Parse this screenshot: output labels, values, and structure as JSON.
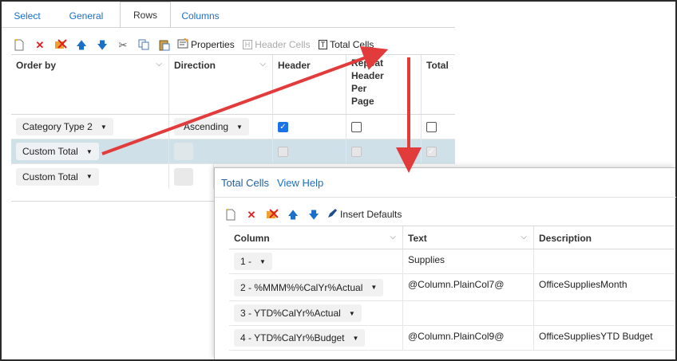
{
  "tabs": [
    {
      "label": "Select"
    },
    {
      "label": "General"
    },
    {
      "label": "Rows"
    },
    {
      "label": "Columns"
    }
  ],
  "toolbar": {
    "properties_label": "Properties",
    "header_cells_label": "Header Cells",
    "total_cells_label": "Total Cells"
  },
  "grid": {
    "columns": [
      "Order by",
      "Direction",
      "Header",
      "Repeat Header Per Page",
      "Total"
    ],
    "repeat_header_lines": [
      "Repeat",
      "Header",
      "Per",
      "Page"
    ],
    "rows": [
      {
        "order_by": "Category Type 2",
        "direction": "Ascending",
        "header": true,
        "repeat": false,
        "total": false
      },
      {
        "order_by": "Custom Total",
        "direction": "",
        "header": false,
        "repeat": false,
        "total": true
      },
      {
        "order_by": "Custom Total",
        "direction": "",
        "header": false,
        "repeat": false,
        "total": false
      }
    ]
  },
  "panel": {
    "title": "Total Cells",
    "help_label": "View Help",
    "insert_defaults_label": "Insert Defaults",
    "columns": [
      "Column",
      "Text",
      "Description"
    ],
    "rows": [
      {
        "column": "1 -",
        "text": "Supplies",
        "description": ""
      },
      {
        "column": "2 - %MMM%%CalYr%Actual",
        "text": "@Column.PlainCol7@",
        "description": "OfficeSuppliesMonth"
      },
      {
        "column": "3 - YTD%CalYr%Actual",
        "text": "",
        "description": ""
      },
      {
        "column": "4 - YTD%CalYr%Budget",
        "text": "@Column.PlainCol9@",
        "description": "OfficeSuppliesYTD Budget"
      }
    ]
  },
  "colors": {
    "link": "#1a6fc9",
    "arrow": "#e23b3b",
    "selected_row": "#cfe0e8",
    "checkbox_on": "#1a73e8"
  }
}
